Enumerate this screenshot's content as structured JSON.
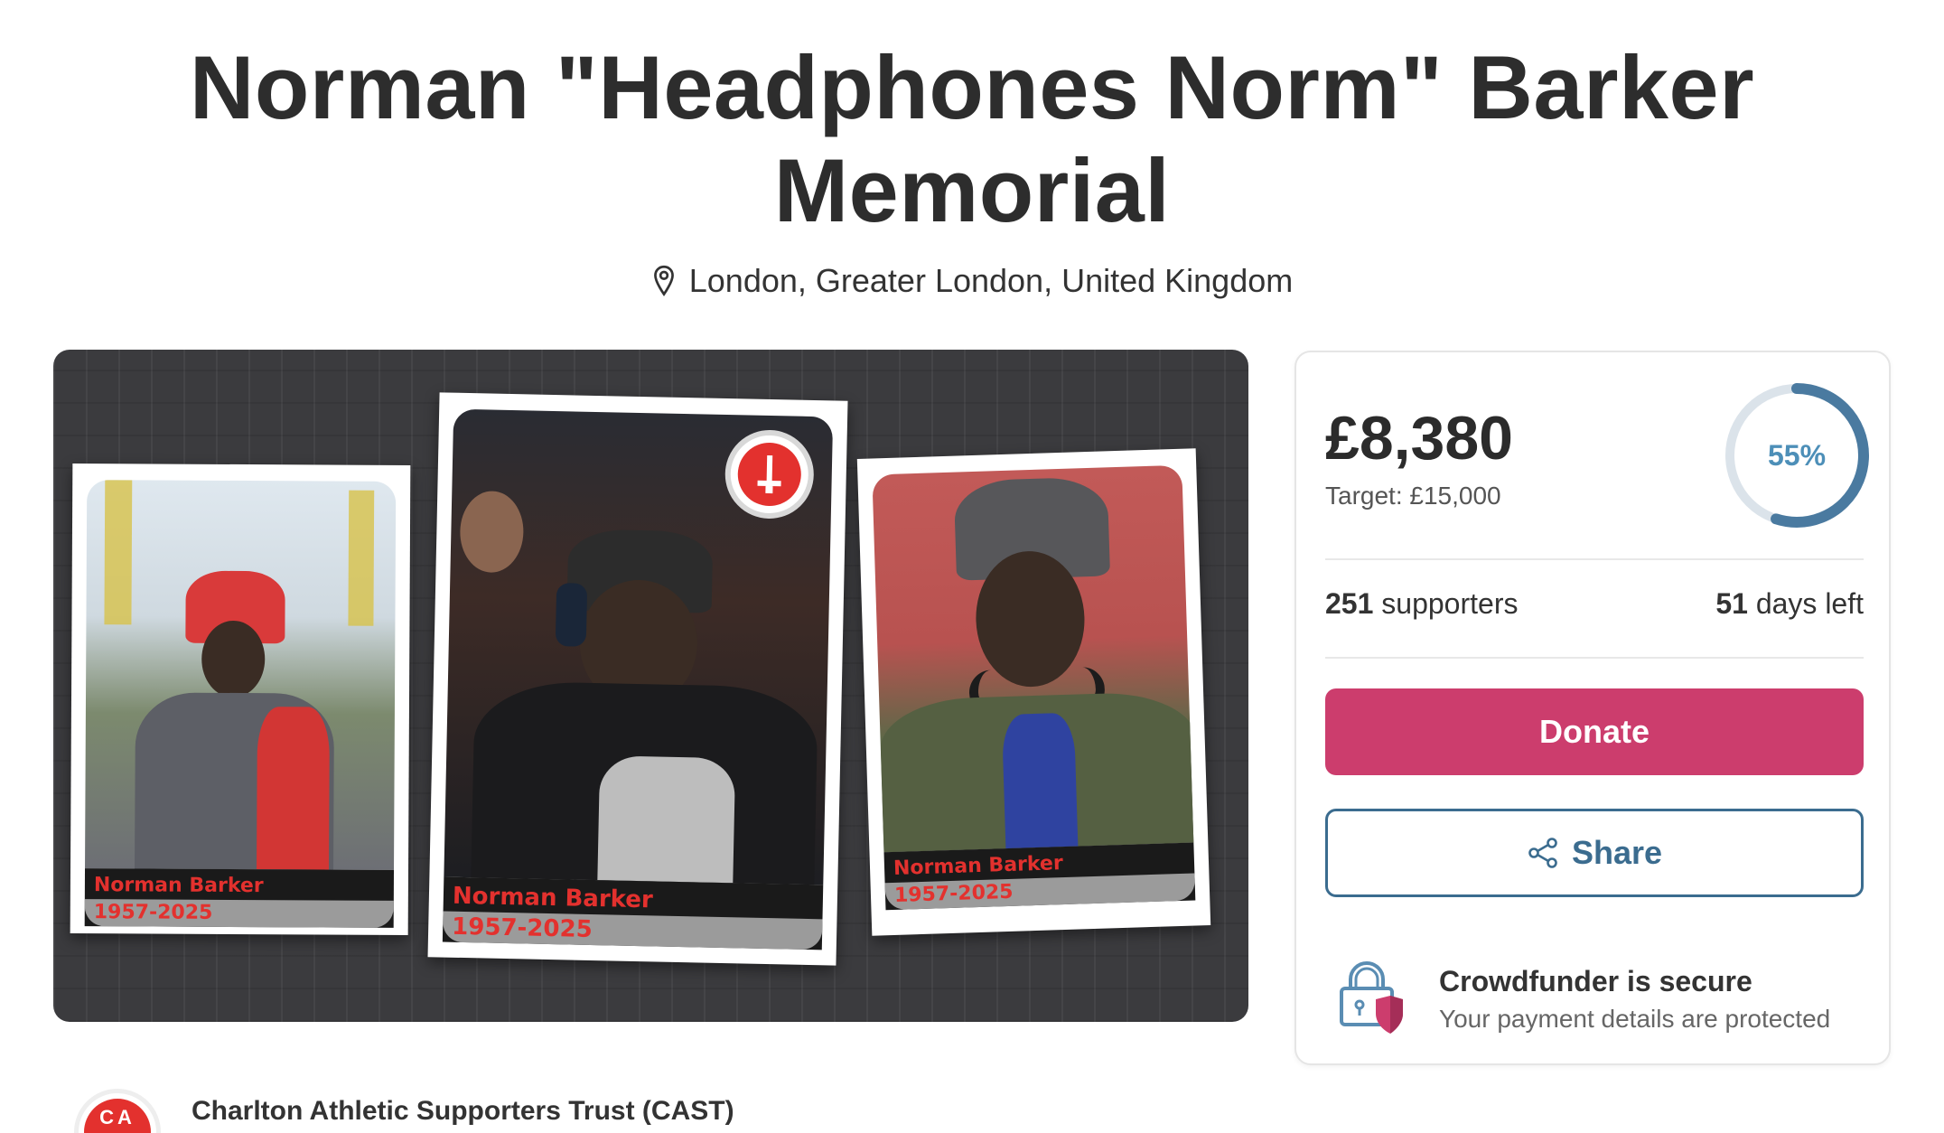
{
  "campaign": {
    "title_line1": "Norman \"Headphones Norm\" Barker",
    "title_line2": "Memorial",
    "location": "London, Greater London, United Kingdom"
  },
  "gallery": {
    "cards": [
      {
        "name": "Norman Barker",
        "years": "1957-2025"
      },
      {
        "name": "Norman Barker",
        "years": "1957-2025"
      },
      {
        "name": "Norman Barker",
        "years": "1957-2025"
      }
    ]
  },
  "donation": {
    "amount": "£8,380",
    "target": "Target: £15,000",
    "progress_percent": 55,
    "progress_label": "55%",
    "supporters_count": "251",
    "supporters_label": "supporters",
    "days_count": "51",
    "days_label": "days left",
    "donate_label": "Donate",
    "share_label": "Share",
    "secure_title": "Crowdfunder is secure",
    "secure_subtitle": "Your payment details are protected"
  },
  "organizer": {
    "name": "Charlton Athletic Supporters Trust (CAST)",
    "avatar_text": "CA"
  },
  "colors": {
    "donate_button": "#cc3d6d",
    "share_border": "#3b6c8f",
    "progress_ring": "#4a7aa0",
    "progress_track": "#dbe3ea",
    "accent_red": "#e3312e"
  },
  "icons": {
    "location": "map-pin-icon",
    "share": "share-icon",
    "secure": "lock-shield-icon"
  }
}
